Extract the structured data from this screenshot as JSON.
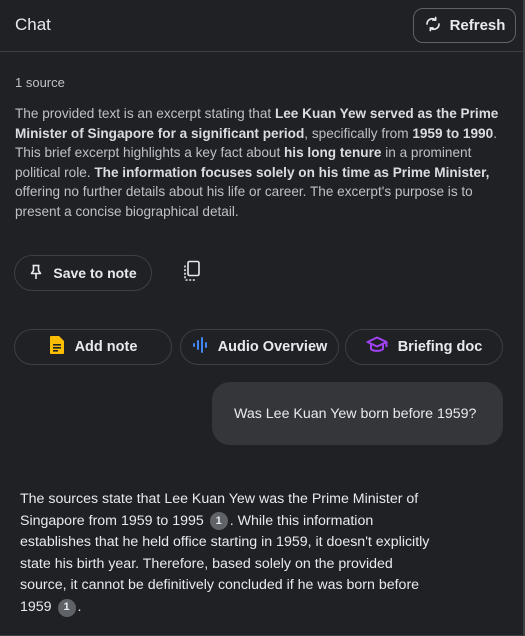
{
  "header": {
    "title": "Chat",
    "refresh_label": "Refresh"
  },
  "source_count": "1 source",
  "summary": {
    "p1": "The provided text is an excerpt stating that ",
    "b1": "Lee Kuan Yew served as the Prime Minister of Singapore for a significant period",
    "p2": ", specifically from ",
    "b2": "1959 to 1990",
    "p3": ". This brief excerpt highlights a key fact about ",
    "b3": "his long tenure",
    "p4": " in a prominent political role. ",
    "b4": "The information focuses solely on his time as Prime Minister,",
    "p5": " offering no further details about his life or career. The excerpt's purpose is to present a concise biographical detail."
  },
  "actions": {
    "save_to_note": "Save to note"
  },
  "chips": {
    "add_note": "Add note",
    "audio_overview": "Audio Overview",
    "briefing_doc": "Briefing doc"
  },
  "colors": {
    "add_note_icon": "#fbbc04",
    "audio_icon": "#4285f4",
    "briefing_icon": "#a142f4"
  },
  "user_message": "Was Lee Kuan Yew born before 1959?",
  "answer": {
    "t1": "The sources state that Lee Kuan Yew was the Prime Minister of Singapore from 1959 to 1995 ",
    "c1": "1",
    "t2": ". While this information establishes that he held office starting in 1959, it doesn't explicitly state his birth year. Therefore, based solely on the provided source, it cannot be definitively concluded if he was born before 1959 ",
    "c2": "1",
    "t3": "."
  }
}
